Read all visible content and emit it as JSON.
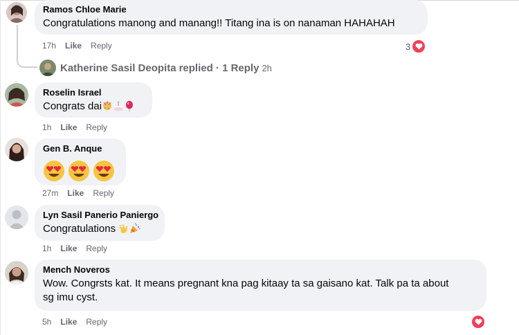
{
  "comments": [
    {
      "author": "Ramos Chloe Marie",
      "text": "Congratulations manong and manang!! Titang ina is on nanaman HAHAHAH",
      "time": "17h",
      "like": "Like",
      "reply": "Reply",
      "reaction_count": "3",
      "replies": {
        "name": "Katherine Sasil Deopita",
        "label": "replied · 1 Reply",
        "time": "2h"
      }
    },
    {
      "author": "Roselin Israel",
      "text": "Congrats dai",
      "emojis": [
        "confetti-ball-icon",
        "birthday-cake-icon",
        "balloon-icon"
      ],
      "time": "1h",
      "like": "Like",
      "reply": "Reply"
    },
    {
      "author": "Gen B. Anque",
      "emojis": [
        "heart-eyes-emoji",
        "heart-eyes-emoji",
        "heart-eyes-emoji"
      ],
      "time": "27m",
      "like": "Like",
      "reply": "Reply"
    },
    {
      "author": "Lyn Sasil Panerio Paniergo",
      "text": "Congratulations",
      "emojis": [
        "clapping-hands-icon",
        "party-popper-icon"
      ],
      "time": "1h",
      "like": "Like",
      "reply": "Reply"
    },
    {
      "author": "Mench Noveros",
      "text_line1": "Wow. Congrsts kat. It means pregnant kna pag kitaay ta sa gaisano kat. Talk pa ta about",
      "text_line2": "sg imu cyst.",
      "time": "5h",
      "like": "Like",
      "reply": "Reply",
      "reaction": "heart"
    }
  ],
  "colors": {
    "bubble": "#f0f2f5",
    "meta": "#65676b",
    "heart": "#f33e58"
  }
}
